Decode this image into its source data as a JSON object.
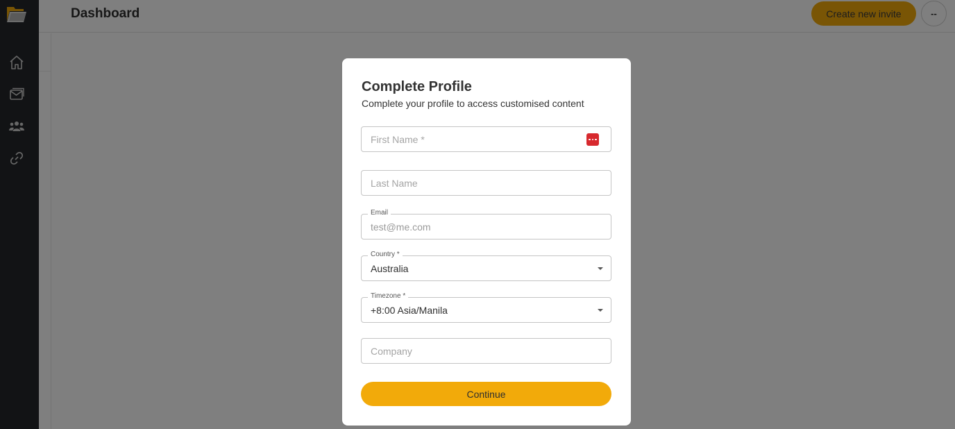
{
  "header": {
    "title": "Dashboard",
    "invite_label": "Create new invite",
    "avatar_label": "--"
  },
  "sidebar": {
    "items": [
      {
        "name": "home",
        "icon": "home-icon"
      },
      {
        "name": "messages",
        "icon": "mail-icon"
      },
      {
        "name": "users",
        "icon": "users-icon"
      },
      {
        "name": "links",
        "icon": "link-icon"
      }
    ]
  },
  "modal": {
    "title": "Complete Profile",
    "subtitle": "Complete your profile to access customised content",
    "first_name_placeholder": "First Name *",
    "last_name_placeholder": "Last Name",
    "email_label": "Email",
    "email_value": "test@me.com",
    "country_label": "Country *",
    "country_value": "Australia",
    "timezone_label": "Timezone *",
    "timezone_value": "+8:00 Asia/Manila",
    "company_placeholder": "Company",
    "continue_label": "Continue"
  },
  "colors": {
    "accent": "#f2aa0a",
    "sidebar_bg": "#25272a",
    "password_manager_icon": "#d7292e"
  }
}
